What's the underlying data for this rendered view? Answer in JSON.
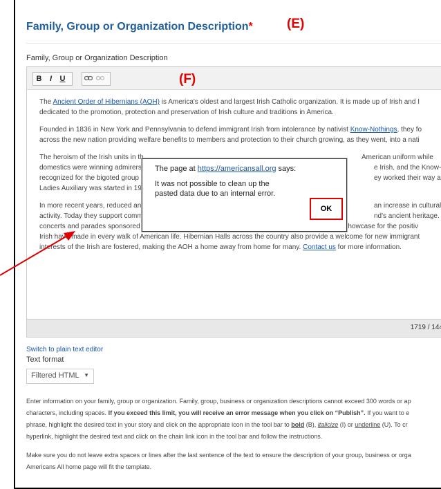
{
  "page": {
    "title": "Family, Group or Organization Description",
    "required_mark": "*",
    "field_label": "Family, Group or Organization Description"
  },
  "callouts": {
    "e": "(E)",
    "f": "(F)"
  },
  "toolbar": {
    "bold": "B",
    "italic": "I",
    "underline": "U"
  },
  "content": {
    "p1": {
      "link": "Ancient Order of Hibernians (AOH)",
      "text_after": " is America's oldest and largest Irish Catholic organization. It is made up of Irish and I",
      "line2": "dedicated to the promotion, protection and preservation of Irish culture and traditions in America."
    },
    "p2": {
      "text_before": "Founded in 1836 in New York and Pennsylvania to defend immigrant Irish from intolerance by nativist ",
      "link": "Know-Nothings",
      "text_after": ", they fo",
      "line2": "across the new nation providing welfare benefits to members and protection to their church growing, as they went, into a nati"
    },
    "p3": {
      "l1a": "The heroism of the Irish units in th",
      "l1b": "American uniform while",
      "l2a": "domestics were winning admirers",
      "l2b": "e Irish, and the Know-",
      "l3a": "recognized for the bigoted group",
      "l3b": "ey worked their way a",
      "l4a": "Ladies Auxiliary was started in 19"
    },
    "p4": {
      "l1a": "In more recent years, reduced an",
      "l1b": "an increase in cultural",
      "l2a": "activity. Today they support comm",
      "l2b": "nd's ancient heritage.",
      "l3": "concerts and parades sponsored at all levels of the Order raise millions for charity while providing a showcase for the positiv",
      "l4": "Irish have made in every walk of American life. Hibernian Halls across the country also provide a welcome for new immigrant",
      "l5_before": "interests of the Irish are fostered, making the AOH a home away from home for many. ",
      "l5_link": "Contact us",
      "l5_after": " for more information."
    }
  },
  "status": {
    "count": "1719 / 144"
  },
  "below": {
    "switch_link": "Switch to plain text editor",
    "text_format_label": "Text format",
    "text_format_value": "Filtered HTML"
  },
  "help": {
    "l1": "Enter information on your family, group or organization. Family, group, business or organization descriptions cannot exceed 300 words or ap",
    "l2_before": "characters, including spaces. ",
    "l2_bold": "If you exceed this limit, you will receive an error message when you click on “Publish”.",
    "l2_after": " If you want to e",
    "l3_a": "phrase, highlight the desired text in your story and click on the appropriate icon in the tool bar to ",
    "l3_bold": "bold",
    "l3_b": " (B), ",
    "l3_italic": "italicize",
    "l3_c": " (I) or ",
    "l3_underline": "underline",
    "l3_d": " (U). To cr",
    "l4": "hyperlink, highlight the desired text and click on the chain link icon in the tool bar and follow the instructions.",
    "l5": "Make sure you do not leave extra spaces or lines after the last sentence of the text to ensure the description of your group, business or orga",
    "l6": "Americans All home page will fit the template."
  },
  "dialog": {
    "title_before": "The page at ",
    "title_link": "https://americansall.org",
    "title_after": " says:",
    "message": "It was not possible to clean up the pasted data due to an internal error.",
    "ok": "OK"
  },
  "colors": {
    "title": "#1f5f9e",
    "callout": "#e00000",
    "link": "#1a56a8"
  }
}
